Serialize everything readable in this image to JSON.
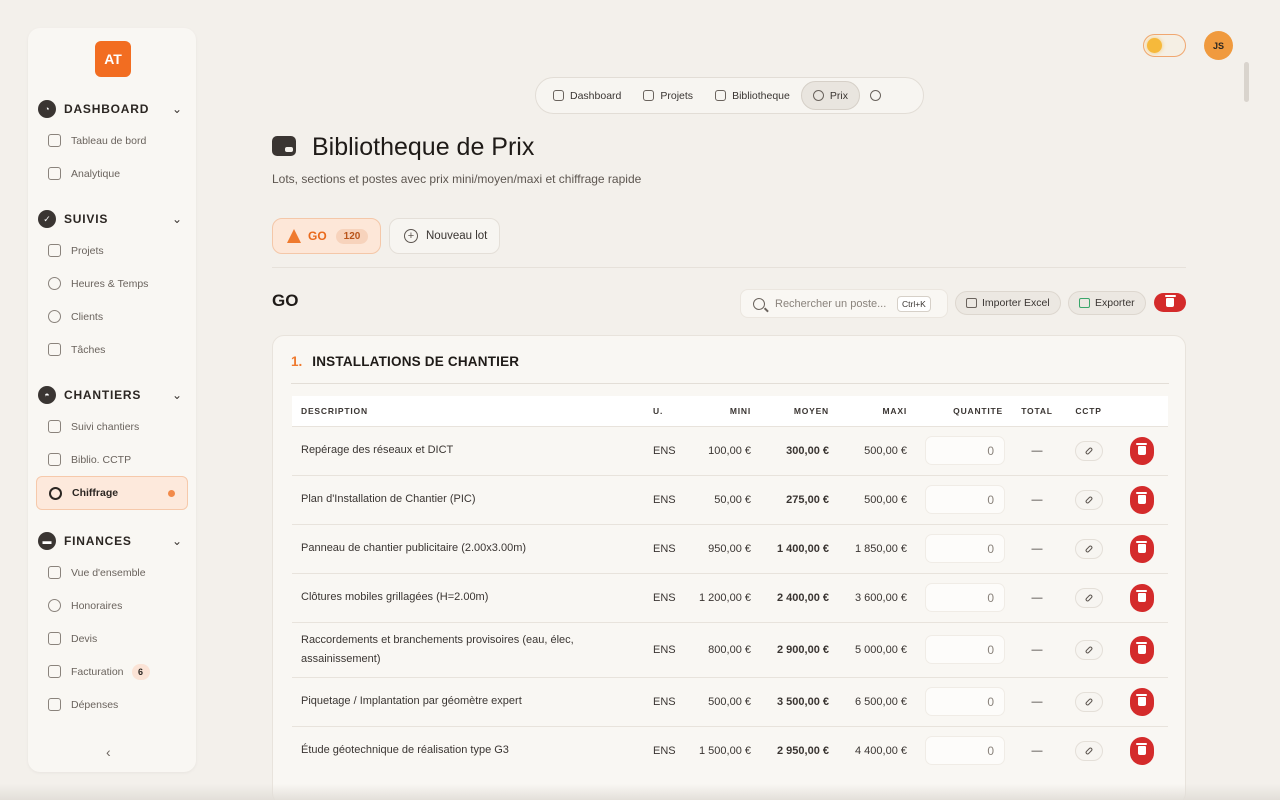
{
  "app": {
    "logo": "AT"
  },
  "topbar": {
    "avatar": "JS",
    "theme_toggle": "sun"
  },
  "sidebar": {
    "sections": [
      {
        "label": "DASHBOARD",
        "icon": "gauge-icon",
        "items": [
          {
            "label": "Tableau de bord",
            "icon": "home-icon"
          },
          {
            "label": "Analytique",
            "icon": "chart-icon"
          }
        ]
      },
      {
        "label": "SUIVIS",
        "icon": "check-icon",
        "items": [
          {
            "label": "Projets",
            "icon": "building-icon"
          },
          {
            "label": "Heures & Temps",
            "icon": "clock-icon"
          },
          {
            "label": "Clients",
            "icon": "users-icon"
          },
          {
            "label": "Tâches",
            "icon": "clipboard-icon"
          }
        ]
      },
      {
        "label": "CHANTIERS",
        "icon": "helmet-icon",
        "items": [
          {
            "label": "Suivi chantiers",
            "icon": "building-icon"
          },
          {
            "label": "Biblio. CCTP",
            "icon": "doc-icon"
          },
          {
            "label": "Chiffrage",
            "icon": "euro-icon",
            "active": true
          }
        ]
      },
      {
        "label": "FINANCES",
        "icon": "wallet-icon",
        "items": [
          {
            "label": "Vue d'ensemble",
            "icon": "folder-icon"
          },
          {
            "label": "Honoraires",
            "icon": "settings-icon"
          },
          {
            "label": "Devis",
            "icon": "doc-icon"
          },
          {
            "label": "Facturation",
            "icon": "invoice-icon",
            "badge": "6"
          },
          {
            "label": "Dépenses",
            "icon": "wallet-icon"
          }
        ]
      }
    ]
  },
  "pillnav": {
    "items": [
      {
        "label": "Dashboard",
        "icon": "home-icon"
      },
      {
        "label": "Projets",
        "icon": "building-icon"
      },
      {
        "label": "Bibliotheque",
        "icon": "book-icon"
      },
      {
        "label": "Prix",
        "icon": "euro-icon",
        "active": true
      }
    ],
    "settings_icon": "gear-icon"
  },
  "header": {
    "title": "Bibliotheque de Prix",
    "subtitle": "Lots, sections et postes avec prix mini/moyen/maxi et chiffrage rapide"
  },
  "lots": {
    "active": {
      "label": "GO",
      "count": "120"
    },
    "new_label": "Nouveau lot"
  },
  "lot_view": {
    "title": "GO",
    "search_placeholder": "Rechercher un poste...",
    "shortcut": "Ctrl+K",
    "import_label": "Importer Excel",
    "export_label": "Exporter"
  },
  "section": {
    "number": "1.",
    "title": "INSTALLATIONS DE CHANTIER",
    "columns": [
      "DESCRIPTION",
      "U.",
      "MINI",
      "MOYEN",
      "MAXI",
      "QUANTITE",
      "TOTAL",
      "CCTP"
    ],
    "rows": [
      {
        "description": "Repérage des réseaux et DICT",
        "unit": "ENS",
        "mini": "100,00 €",
        "moyen": "300,00 €",
        "maxi": "500,00 €",
        "quantity": "0",
        "total": "—"
      },
      {
        "description": "Plan d'Installation de Chantier (PIC)",
        "unit": "ENS",
        "mini": "50,00 €",
        "moyen": "275,00 €",
        "maxi": "500,00 €",
        "quantity": "0",
        "total": "—"
      },
      {
        "description": "Panneau de chantier publicitaire (2.00x3.00m)",
        "unit": "ENS",
        "mini": "950,00 €",
        "moyen": "1 400,00 €",
        "maxi": "1 850,00 €",
        "quantity": "0",
        "total": "—"
      },
      {
        "description": "Clôtures mobiles grillagées (H=2.00m)",
        "unit": "ENS",
        "mini": "1 200,00 €",
        "moyen": "2 400,00 €",
        "maxi": "3 600,00 €",
        "quantity": "0",
        "total": "—"
      },
      {
        "description": "Raccordements et branchements provisoires (eau, élec, assainissement)",
        "unit": "ENS",
        "mini": "800,00 €",
        "moyen": "2 900,00 €",
        "maxi": "5 000,00 €",
        "quantity": "0",
        "total": "—"
      },
      {
        "description": "Piquetage / Implantation par géomètre expert",
        "unit": "ENS",
        "mini": "500,00 €",
        "moyen": "3 500,00 €",
        "maxi": "6 500,00 €",
        "quantity": "0",
        "total": "—"
      },
      {
        "description": "Étude géotechnique de réalisation type G3",
        "unit": "ENS",
        "mini": "1 500,00 €",
        "moyen": "2 950,00 €",
        "maxi": "4 400,00 €",
        "quantity": "0",
        "total": "—"
      }
    ]
  },
  "colors": {
    "accent": "#ef7a2e",
    "danger": "#d42b2b",
    "logo": "#f26d21"
  }
}
